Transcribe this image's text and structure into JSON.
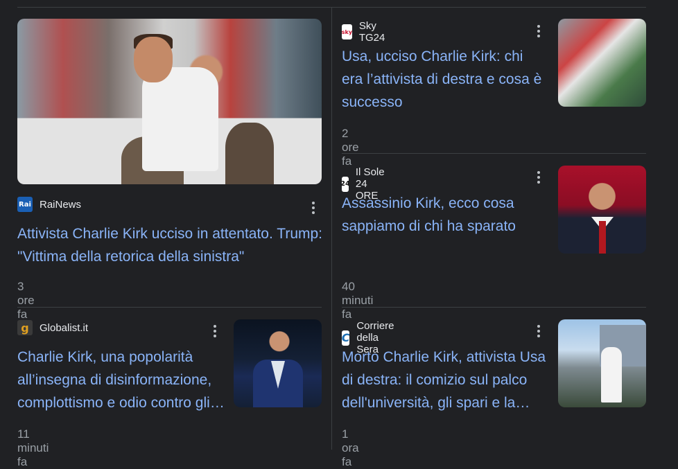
{
  "cards": [
    {
      "source": "RaiNews",
      "logo_text": "Rai",
      "logo_bg": "#1a5fb4",
      "logo_fg": "#ffffff",
      "icon": "rainews-logo",
      "title": "Attivista Charlie Kirk ucciso in attentato. Trump: \"Vittima della retorica della sinistra\"",
      "time": "3 ore fa"
    },
    {
      "source": "Sky TG24",
      "logo_text": "sky",
      "logo_bg": "#ffffff",
      "logo_fg": "#c8102e",
      "icon": "skytg24-logo",
      "title": "Usa, ucciso Charlie Kirk: chi era l’attivista di destra e cosa è successo",
      "time": "2 ore fa"
    },
    {
      "source": "Il Sole 24 ORE",
      "logo_text": "24",
      "logo_bg": "#ffffff",
      "logo_fg": "#111111",
      "icon": "ilsole24ore-logo",
      "title": "Assassinio Kirk, ecco cosa sappiamo di chi ha sparato",
      "time": "40 minuti fa"
    },
    {
      "source": "Globalist.it",
      "logo_text": "g",
      "logo_bg": "#3a3a3a",
      "logo_fg": "#e0a020",
      "icon": "globalist-logo",
      "title": "Charlie Kirk, una popolarità all’insegna di disinformazione, complottismo e odio contro gli immigrati",
      "time": "11 minuti fa"
    },
    {
      "source": "Corriere della Sera",
      "logo_text": "C",
      "logo_bg": "#ffffff",
      "logo_fg": "#1f6fb2",
      "icon": "corriere-logo",
      "title": "Morto Charlie Kirk, attivista Usa di destra: il comizio sul palco dell'università, gli spari e la morte",
      "time": "1 ora fa"
    }
  ]
}
